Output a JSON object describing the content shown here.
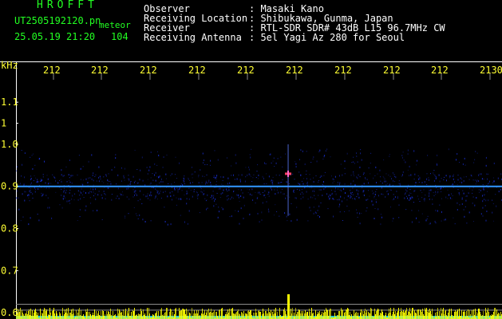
{
  "header": {
    "title": "HROFFT",
    "filename": "UT2505192120.pn",
    "meteor_label": "meteor",
    "datetime": "25.05.19 21:20",
    "count": "104",
    "info": [
      {
        "label": "Observer",
        "value": ": Masaki Kano"
      },
      {
        "label": "Receiving Location",
        "value": ": Shibukawa, Gunma, Japan"
      },
      {
        "label": "Receiver",
        "value": ": RTL-SDR SDR# 43dB L15 96.7MHz CW"
      },
      {
        "label": "Receiving Antenna",
        "value": ": 5el Yagi Az 280 for Seoul"
      }
    ]
  },
  "chart_data": {
    "type": "heatmap",
    "ylabel": "kHz",
    "x_tick_labels": [
      "212",
      "212",
      "212",
      "212",
      "212",
      "212",
      "212",
      "212",
      "212",
      "2130"
    ],
    "y_tick_labels": [
      "1.1",
      "1",
      "1.0",
      "0.9",
      "0.8",
      "0.7",
      "0.6"
    ],
    "y_ticks": [
      1.1,
      1.05,
      1.0,
      0.9,
      0.8,
      0.7,
      0.6
    ],
    "ylim": [
      0.585,
      1.195
    ],
    "carrier_khz": 0.9,
    "noise_band_khz": [
      0.81,
      0.99
    ],
    "meteor_echo": {
      "x_fraction": 0.56,
      "khz": 0.93
    },
    "reference_lines_khz": [
      0.62,
      0.606
    ],
    "colors": {
      "carrier": "#3399ff",
      "noise": "#1a2fd0",
      "grid": "#8a8a8a",
      "text": "#ffff33",
      "axis": "#ffffff",
      "spectrum": "#ffff00",
      "floor": "#00bfff"
    }
  }
}
